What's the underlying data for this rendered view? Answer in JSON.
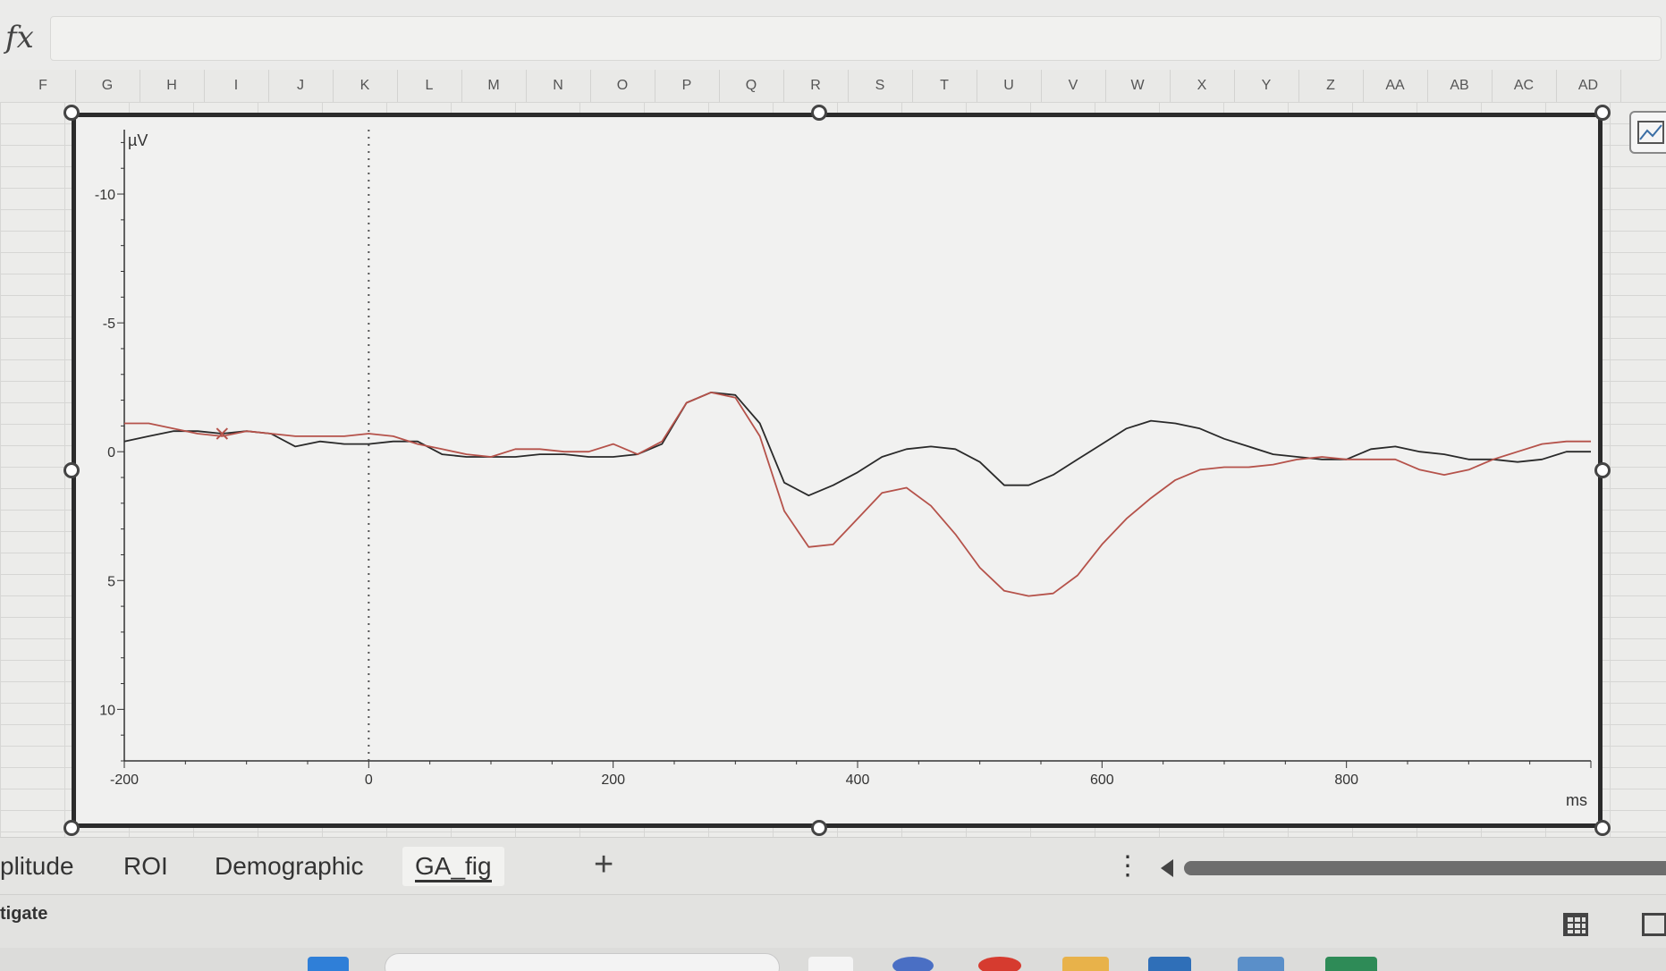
{
  "formula_bar": {
    "fx_label": "fx",
    "value": ""
  },
  "columns": [
    "F",
    "G",
    "H",
    "I",
    "J",
    "K",
    "L",
    "M",
    "N",
    "O",
    "P",
    "Q",
    "R",
    "S",
    "T",
    "U",
    "V",
    "W",
    "X",
    "Y",
    "Z",
    "AA",
    "AB",
    "AC",
    "AD"
  ],
  "chart_data": {
    "type": "line",
    "title": "",
    "xlabel": "ms",
    "ylabel": "µV",
    "xlim": [
      -200,
      1000
    ],
    "ylim": [
      -12.5,
      12
    ],
    "y_inverted": true,
    "x_ticks": [
      -200,
      0,
      200,
      400,
      600,
      800
    ],
    "x_tick_labels": [
      "-200",
      "0",
      "200",
      "400",
      "600",
      "800"
    ],
    "y_ticks": [
      -10,
      -5,
      0,
      5,
      10
    ],
    "y_tick_labels": [
      "-10",
      "-5",
      "0",
      "5",
      "10"
    ],
    "grid": false,
    "vertical_marker_x": 0,
    "colors": {
      "series_1": "#2a2a2a",
      "series_2": "#b5524a"
    },
    "series": [
      {
        "x": [
          -200,
          -180,
          -160,
          -140,
          -120,
          -100,
          -80,
          -60,
          -40,
          -20,
          0,
          20,
          40,
          60,
          80,
          100,
          120,
          140,
          160,
          180,
          200,
          220,
          240,
          260,
          280,
          300,
          320,
          340,
          360,
          380,
          400,
          420,
          440,
          460,
          480,
          500,
          520,
          540,
          560,
          580,
          600,
          620,
          640,
          660,
          680,
          700,
          720,
          740,
          760,
          780,
          800,
          820,
          840,
          860,
          880,
          900,
          920,
          940,
          960,
          980,
          1000
        ],
        "y": [
          -0.4,
          -0.6,
          -0.8,
          -0.8,
          -0.7,
          -0.8,
          -0.7,
          -0.2,
          -0.4,
          -0.3,
          -0.3,
          -0.4,
          -0.4,
          0.1,
          0.2,
          0.2,
          0.2,
          0.1,
          0.1,
          0.2,
          0.2,
          0.1,
          -0.3,
          -1.9,
          -2.3,
          -2.2,
          -1.1,
          1.2,
          1.7,
          1.3,
          0.8,
          0.2,
          -0.1,
          -0.2,
          -0.1,
          0.4,
          1.3,
          1.3,
          0.9,
          0.3,
          -0.3,
          -0.9,
          -1.2,
          -1.1,
          -0.9,
          -0.5,
          -0.2,
          0.1,
          0.2,
          0.3,
          0.3,
          -0.1,
          -0.2,
          0.0,
          0.1,
          0.3,
          0.3,
          0.4,
          0.3,
          0.0,
          0.0
        ]
      },
      {
        "x": [
          -200,
          -180,
          -160,
          -140,
          -120,
          -100,
          -80,
          -60,
          -40,
          -20,
          0,
          20,
          40,
          60,
          80,
          100,
          120,
          140,
          160,
          180,
          200,
          220,
          240,
          260,
          280,
          300,
          320,
          340,
          360,
          380,
          400,
          420,
          440,
          460,
          480,
          500,
          520,
          540,
          560,
          580,
          600,
          620,
          640,
          660,
          680,
          700,
          720,
          740,
          760,
          780,
          800,
          820,
          840,
          860,
          880,
          900,
          920,
          940,
          960,
          980,
          1000
        ],
        "y": [
          -1.1,
          -1.1,
          -0.9,
          -0.7,
          -0.6,
          -0.8,
          -0.7,
          -0.6,
          -0.6,
          -0.6,
          -0.7,
          -0.6,
          -0.3,
          -0.1,
          0.1,
          0.2,
          -0.1,
          -0.1,
          0.0,
          0.0,
          -0.3,
          0.1,
          -0.4,
          -1.9,
          -2.3,
          -2.1,
          -0.6,
          2.3,
          3.7,
          3.6,
          2.6,
          1.6,
          1.4,
          2.1,
          3.2,
          4.5,
          5.4,
          5.6,
          5.5,
          4.8,
          3.6,
          2.6,
          1.8,
          1.1,
          0.7,
          0.6,
          0.6,
          0.5,
          0.3,
          0.2,
          0.3,
          0.3,
          0.3,
          0.7,
          0.9,
          0.7,
          0.3,
          0.0,
          -0.3,
          -0.4,
          -0.4
        ]
      }
    ]
  },
  "sheet_tabs": [
    {
      "label": "plitude",
      "active": false
    },
    {
      "label": "ROI",
      "active": false
    },
    {
      "label": "Demographic",
      "active": false
    },
    {
      "label": "GA_fig",
      "active": true
    }
  ],
  "add_sheet_label": "+",
  "more_label": "⋮",
  "status": {
    "left_text": "tigate"
  },
  "icons": {
    "formula": "fx-icon",
    "add_sheet": "plus-icon",
    "more": "more-vertical-icon",
    "scroll_left": "triangle-left-icon",
    "grid_view": "grid-view-icon",
    "page_view": "page-layout-icon",
    "chart_type": "chart-icon"
  }
}
